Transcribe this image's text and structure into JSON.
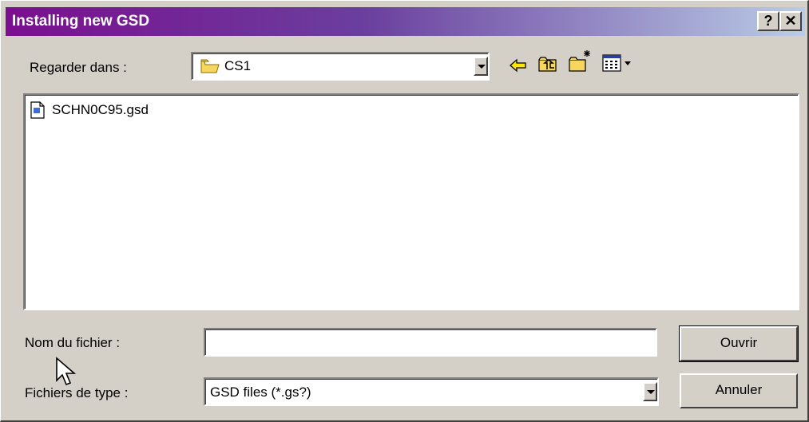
{
  "window": {
    "title": "Installing new GSD",
    "help_label": "?",
    "close_label": "✕"
  },
  "lookin": {
    "label": "Regarder dans :",
    "value": "CS1"
  },
  "toolbar": {
    "back_icon": "back-arrow-icon",
    "up_icon": "up-folder-icon",
    "new_folder_icon": "new-folder-icon",
    "view_icon": "view-menu-icon"
  },
  "files": [
    {
      "name": "SCHN0C95.gsd"
    }
  ],
  "filename": {
    "label": "Nom du fichier :",
    "value": ""
  },
  "filetype": {
    "label": "Fichiers de type :",
    "value": "GSD files (*.gs?)"
  },
  "buttons": {
    "open": "Ouvrir",
    "cancel": "Annuler"
  }
}
